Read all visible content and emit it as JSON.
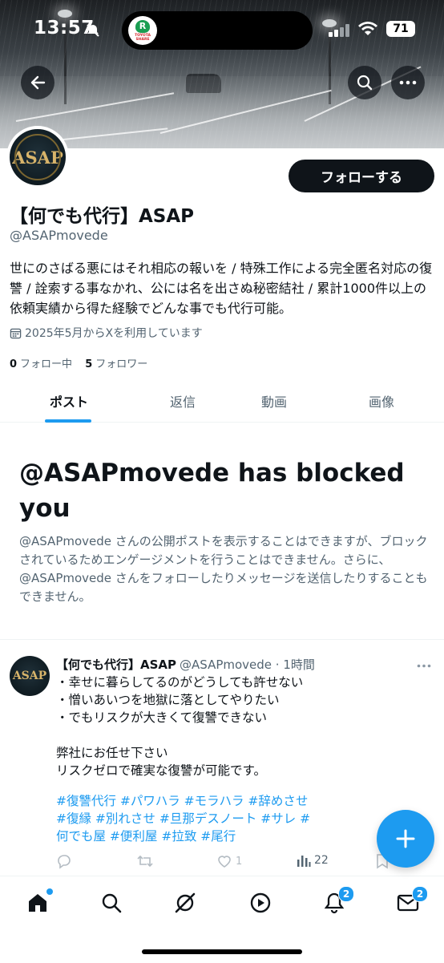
{
  "status_bar": {
    "time": "13:57",
    "battery": "71",
    "island_app_text": "TOYOTA SHARE"
  },
  "profile": {
    "avatar_text": "ASAP",
    "follow_label": "フォローする",
    "display_name": "【何でも代行】ASAP",
    "handle": "@ASAPmovede",
    "bio": "世にのさばる悪にはそれ相応の報いを / 特殊工作による完全匿名対応の復讐 / 詮索する事なかれ、公には名を出さぬ秘密結社 / 累計1000件以上の依頼実績から得た経験でどんな事でも代行可能。",
    "joined": "2025年5月からXを利用しています",
    "following_count": "0",
    "following_label": "フォロー中",
    "followers_count": "5",
    "followers_label": "フォロワー"
  },
  "tabs": [
    {
      "label": "ポスト",
      "active": true
    },
    {
      "label": "返信",
      "active": false
    },
    {
      "label": "動画",
      "active": false
    },
    {
      "label": "画像",
      "active": false
    }
  ],
  "blocked": {
    "title": "@ASAPmovede has blocked you",
    "body": "@ASAPmovede さんの公開ポストを表示することはできますが、ブロックされているためエンゲージメントを行うことはできません。さらに、@ASAPmovede さんをフォローしたりメッセージを送信したりすることもできません。"
  },
  "post": {
    "author": "【何でも代行】ASAP",
    "handle_time": "@ASAPmovede · 1時間",
    "lines": [
      "・幸せに暮らしてるのがどうしても許せない",
      "・憎いあいつを地獄に落としてやりたい",
      "・でもリスクが大きくて復讐できない",
      "",
      "弊社にお任せ下さい",
      "リスクゼロで確実な復讐が可能です。"
    ],
    "hashtags": "#復讐代行 #パワハラ #モラハラ #辞めさせ #復縁 #別れさせ #旦那デスノート #サレ #何でも屋 #便利屋 #拉致 #尾行",
    "views": "22"
  },
  "nav": {
    "notifications_badge": "2",
    "messages_badge": "2"
  },
  "colors": {
    "accent": "#1d9bf0",
    "text": "#0f1419",
    "muted": "#536471"
  },
  "icons": [
    "back-arrow-icon",
    "search-icon",
    "more-icon",
    "calendar-icon",
    "reply-icon",
    "retweet-icon",
    "like-icon",
    "views-icon",
    "bookmark-icon",
    "compose-plus-icon",
    "home-icon",
    "explore-icon",
    "grok-icon",
    "video-icon",
    "bell-icon",
    "mail-icon"
  ]
}
